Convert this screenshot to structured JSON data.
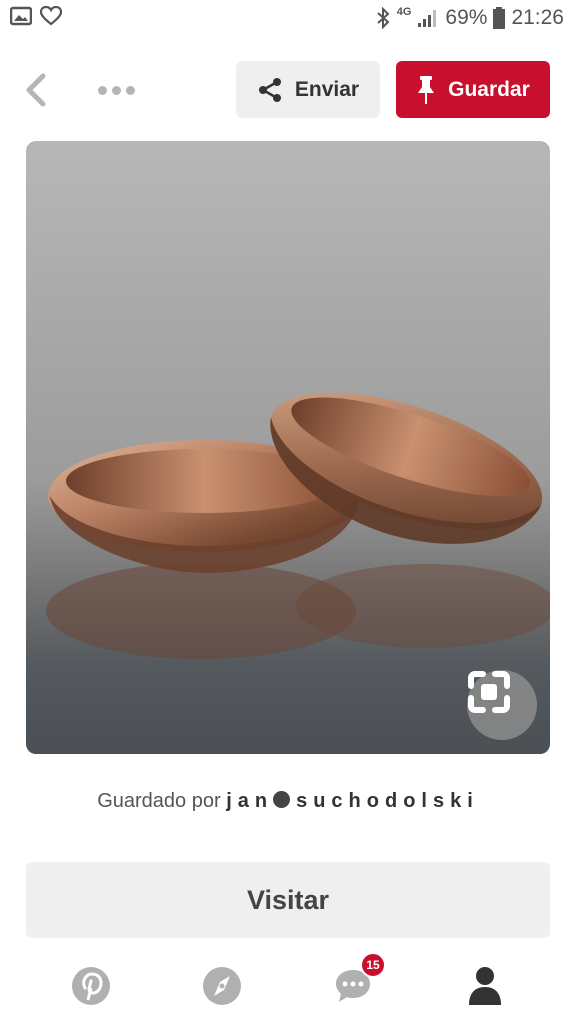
{
  "status_bar": {
    "left_icons": [
      "gallery-icon",
      "heart-outline-icon"
    ],
    "right_icons": [
      "bluetooth-icon",
      "signal-icon",
      "battery-icon"
    ],
    "network": "4G",
    "battery": "69%",
    "time": "21:26"
  },
  "toolbar": {
    "send_label": "Enviar",
    "save_label": "Guardar"
  },
  "pin": {
    "expand_icon": "visual-search-icon"
  },
  "saved_by": {
    "prefix": "Guardado por",
    "user_first": "jan",
    "user_last": "suchodolski"
  },
  "visit_label": "Visitar",
  "bottom_nav": {
    "items": [
      "home-icon",
      "explore-icon",
      "messages-icon",
      "profile-icon"
    ],
    "messages_badge": "15"
  },
  "colors": {
    "brand_red": "#c8102e",
    "button_gray": "#efefef"
  }
}
